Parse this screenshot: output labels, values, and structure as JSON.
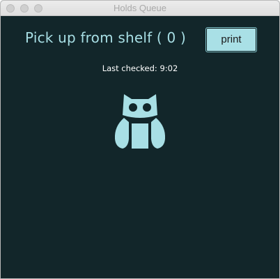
{
  "window": {
    "title": "Holds Queue"
  },
  "main": {
    "heading": "Pick up from shelf ( 0 )",
    "print_label": "print",
    "last_checked": "Last checked: 9:02"
  },
  "icons": {
    "logo": "owl-icon"
  },
  "colors": {
    "background": "#12262a",
    "accent": "#a8dfe5",
    "button": "#a9e0e6",
    "text_white": "#ffffff"
  }
}
